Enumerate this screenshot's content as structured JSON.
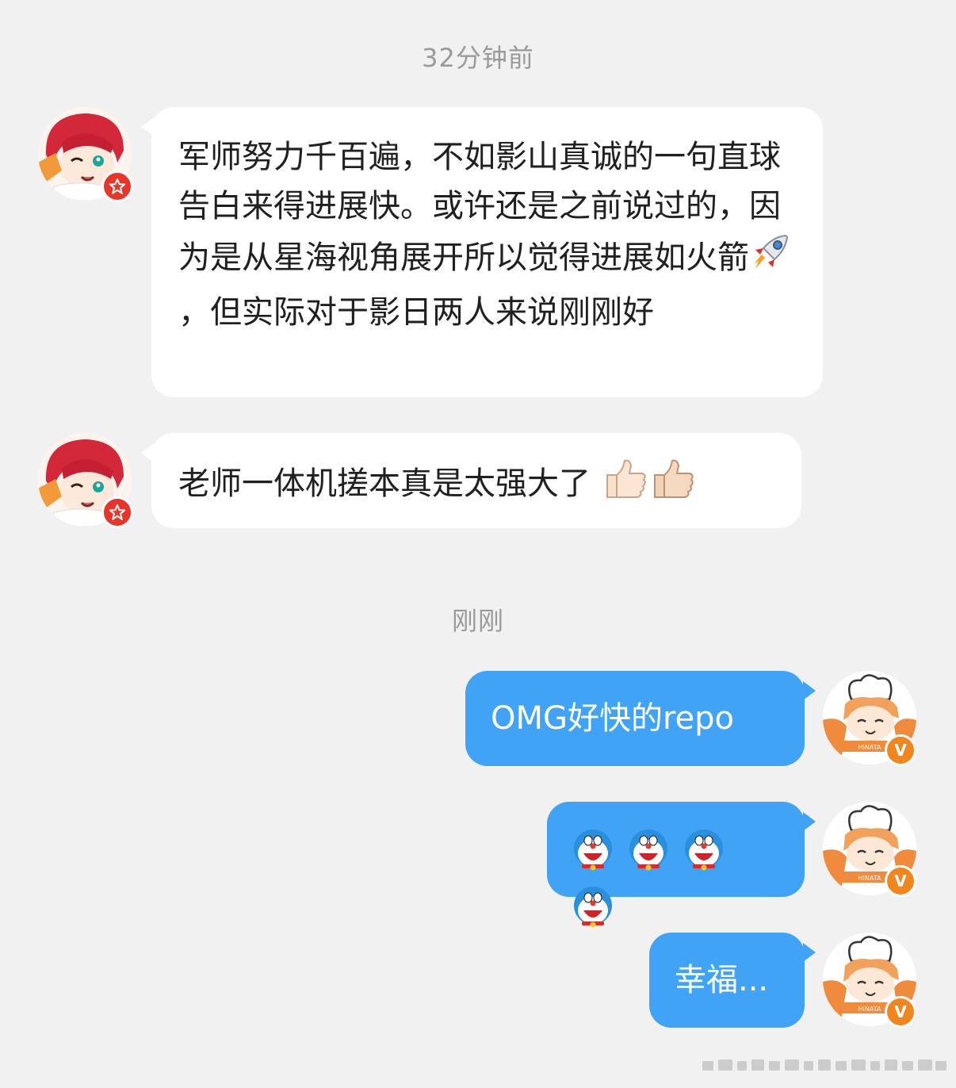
{
  "chat": {
    "timestamp_1": "32分钟前",
    "timestamp_2": "刚刚",
    "messages": [
      {
        "side": "left",
        "sender": "other",
        "text_before_icon": "军师努力千百遍，不如影山真诚的一句直球告白来得进展快。或许还是之前说过的，因为是从星海视角展开所以觉得进展如火箭",
        "inline_icon": "rocket-emoji",
        "text_after_icon": "，但实际对于影日两人来说刚刚好"
      },
      {
        "side": "left",
        "sender": "other",
        "text": "老师一体机搓本真是太强大了",
        "trailing_icons": [
          "thumbs-up-emoji-light",
          "thumbs-up-emoji-medium"
        ]
      },
      {
        "side": "right",
        "sender": "me",
        "text": "OMG好快的repo"
      },
      {
        "side": "right",
        "sender": "me",
        "icons": [
          "doraemon-emoji",
          "doraemon-emoji",
          "doraemon-emoji",
          "doraemon-emoji"
        ]
      },
      {
        "side": "right",
        "sender": "me",
        "text": "幸福..."
      }
    ]
  },
  "avatars": {
    "other": {
      "badge_icon": "star-badge-icon",
      "badge_color": "#e7352a"
    },
    "me": {
      "label": "HINATA",
      "badge_text": "V",
      "badge_color": "#f2861e"
    }
  },
  "colors": {
    "background": "#f1f1f1",
    "incoming_bubble": "#ffffff",
    "outgoing_bubble": "#41a3f5",
    "timestamp_text": "#9a9a9a"
  }
}
